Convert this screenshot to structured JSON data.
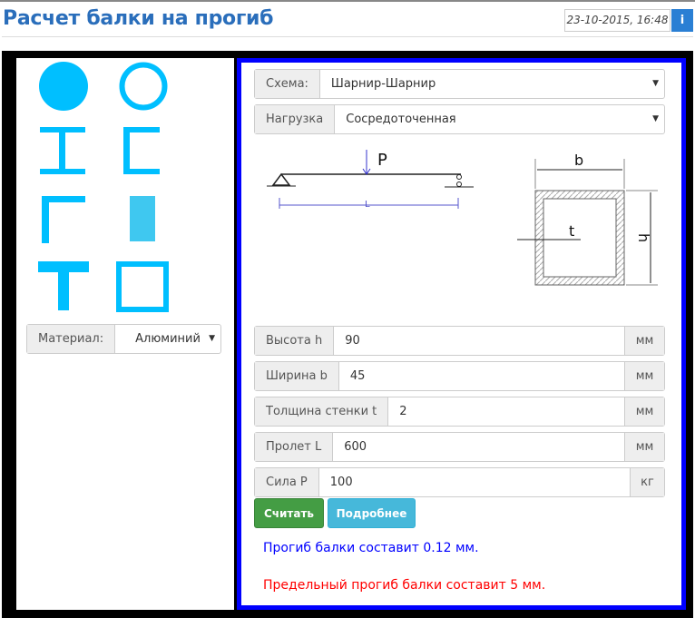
{
  "header": {
    "title": "Расчет балки на прогиб",
    "datetime": "23-10-2015, 16:48",
    "info_icon": "i"
  },
  "colors": {
    "shape": "#00bfff",
    "frame": "#000000",
    "panel_border": "#0000ff",
    "result": "#0000ff",
    "limit": "#ff0000"
  },
  "left": {
    "shapes": [
      "circle",
      "tube-round",
      "i-beam",
      "channel",
      "angle",
      "rectangle",
      "t-beam",
      "tube-square"
    ],
    "material_label": "Материал:",
    "material_value": "Алюминий"
  },
  "form": {
    "scheme_label": "Схема:",
    "scheme_value": "Шарнир-Шарнир",
    "load_label": "Нагрузка",
    "load_value": "Сосредоточенная",
    "diagram": {
      "force": "P",
      "length": "L",
      "width": "b",
      "height": "h",
      "thickness": "t"
    },
    "fields": [
      {
        "label": "Высота h",
        "value": "90",
        "unit": "мм"
      },
      {
        "label": "Ширина b",
        "value": "45",
        "unit": "мм"
      },
      {
        "label": "Толщина стенки t",
        "value": "2",
        "unit": "мм"
      },
      {
        "label": "Пролет L",
        "value": "600",
        "unit": "мм"
      },
      {
        "label": "Сила P",
        "value": "100",
        "unit": "кг"
      }
    ],
    "calc_button": "Считать",
    "details_button": "Подробнее"
  },
  "results": {
    "deflection": "Прогиб балки составит 0.12 мм.",
    "limit": "Предельный прогиб балки составит 5 мм."
  }
}
